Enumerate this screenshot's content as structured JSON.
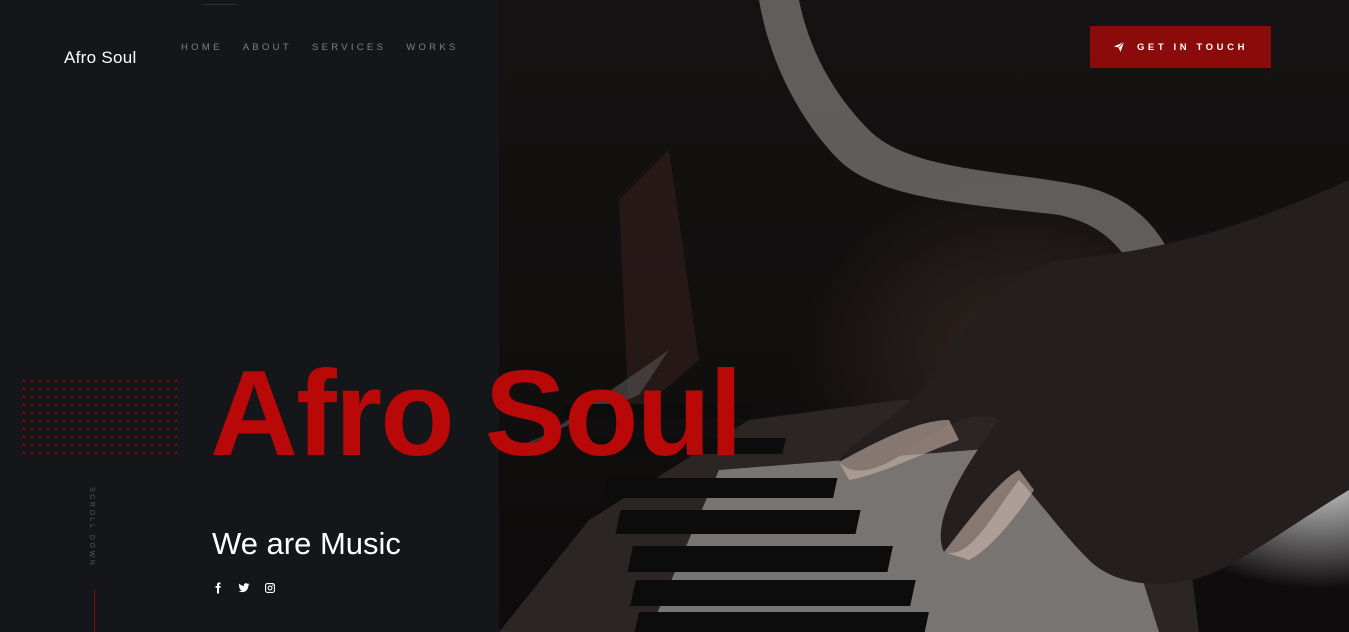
{
  "header": {
    "brand": "Afro Soul",
    "nav": [
      "HOME",
      "ABOUT",
      "SERVICES",
      "WORKS"
    ],
    "cta_label": "GET IN TOUCH",
    "cta_icon": "paper-plane-icon"
  },
  "hero": {
    "title": "Afro Soul",
    "subtitle": "We are Music",
    "scroll_label": "SCROLL DOWN",
    "socials": [
      "facebook-icon",
      "twitter-icon",
      "instagram-icon"
    ]
  },
  "colors": {
    "accent": "#b80808",
    "button": "#8b0a0a",
    "background": "#151619",
    "nav_text": "#7d8086"
  }
}
